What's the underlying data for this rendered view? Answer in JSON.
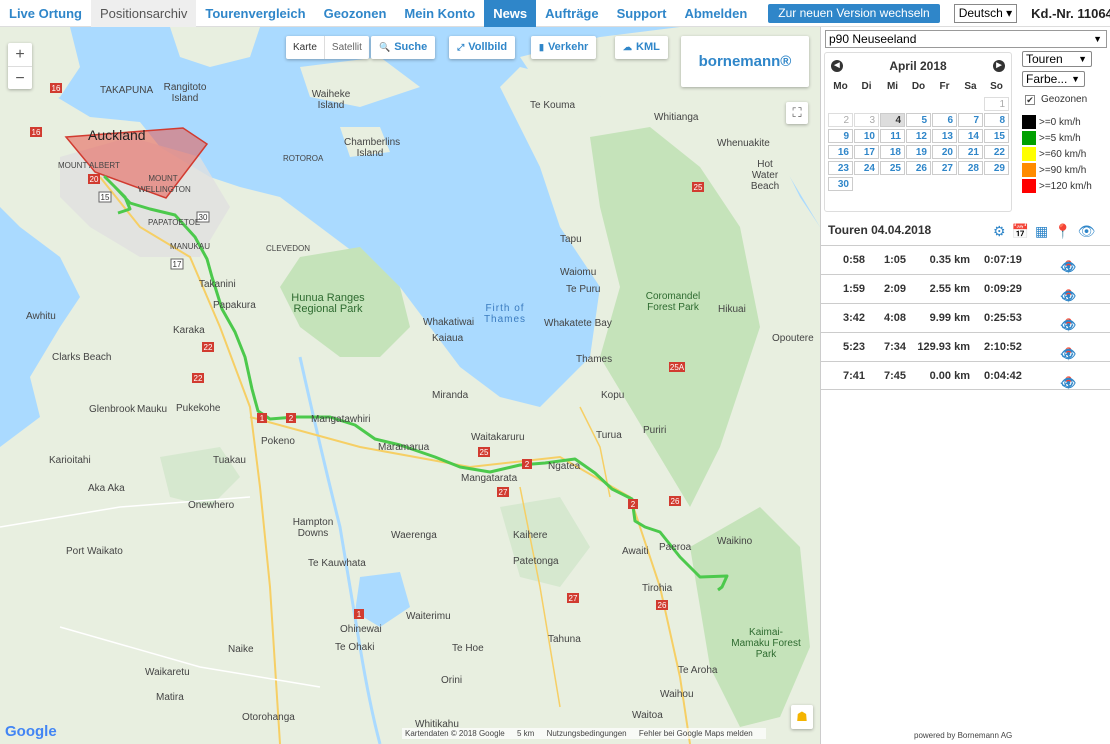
{
  "nav": {
    "items": [
      {
        "label": "Live Ortung"
      },
      {
        "label": "Positionsarchiv"
      },
      {
        "label": "Tourenvergleich"
      },
      {
        "label": "Geozonen"
      },
      {
        "label": "Mein Konto"
      },
      {
        "label": "News"
      },
      {
        "label": "Aufträge"
      },
      {
        "label": "Support"
      },
      {
        "label": "Abmelden"
      }
    ],
    "active": "News",
    "version_button": "Zur neuen Version wechseln",
    "language": "Deutsch",
    "customer_number": "Kd.-Nr. 11064"
  },
  "map": {
    "zoom_in": "+",
    "zoom_out": "−",
    "type_map": "Karte",
    "type_satellite": "Satellit",
    "buttons": {
      "search": "Suche",
      "fullscreen": "Vollbild",
      "traffic": "Verkehr",
      "kml": "KML"
    },
    "logo": "bornemann®",
    "google": "Google",
    "attribution": {
      "data": "Kartendaten © 2018 Google",
      "scale": "5 km",
      "terms": "Nutzungsbedingungen",
      "report": "Fehler bei Google Maps melden"
    },
    "labels": {
      "auckland": "Auckland",
      "takapuna": "TAKAPUNA",
      "rangitoto": "Rangitoto Island",
      "waiheke": "Waiheke Island",
      "chamberlins": "Chamberlins Island",
      "rotoroa": "ROTOROA",
      "tekouma": "Te Kouma",
      "whitianga": "Whitianga",
      "whenuakite": "Whenuakite",
      "hotwater": "Hot Water Beach",
      "mtalbert": "MOUNT ALBERT",
      "mtwellington": "MOUNT WELLINGTON",
      "manukau": "MANUKAU",
      "papatoetoe": "PAPATOETOE",
      "clevedon": "CLEVEDON",
      "tapu": "Tapu",
      "waiomu": "Waiomu",
      "tepuru": "Te Puru",
      "takanini": "Takanini",
      "papakura": "Papakura",
      "hunua": "Hunua Ranges Regional Park",
      "firth": "Firth of Thames",
      "coromandel": "Coromandel Forest Park",
      "hikuai": "Hikuai",
      "awhitu": "Awhitu",
      "karaka": "Karaka",
      "whakatiwai": "Whakatiwai",
      "kaiaua": "Kaiaua",
      "whakatete": "Whakatete Bay",
      "opoutere": "Opoutere",
      "clarks": "Clarks Beach",
      "thames": "Thames",
      "glenbrook": "Glenbrook",
      "mauku": "Mauku",
      "pukekohe": "Pukekohe",
      "miranda": "Miranda",
      "kopu": "Kopu",
      "mangatawhiri": "Mangatawhiri",
      "pokeno": "Pokeno",
      "waitakaruru": "Waitakaruru",
      "turua": "Turua",
      "puriri": "Puriri",
      "karioitahi": "Karioitahi",
      "tuakau": "Tuakau",
      "maramarua": "Maramarua",
      "mangatarata": "Mangatarata",
      "ngatea": "Ngatea",
      "aka": "Aka Aka",
      "onewhero": "Onewhero",
      "kaihere": "Kaihere",
      "awaiti": "Awaiti",
      "paeroa": "Paeroa",
      "waikino": "Waikino",
      "hampton": "Hampton Downs",
      "waerenga": "Waerenga",
      "patetonga": "Patetonga",
      "tirohia": "Tirohia",
      "portwaikato": "Port Waikato",
      "tekauwhata": "Te Kauwhata",
      "waiterimu": "Waiterimu",
      "ohinewai": "Ohinewai",
      "teohaki": "Te Ohaki",
      "tehoe": "Te Hoe",
      "tahuna": "Tahuna",
      "kaimai": "Kaimai-Mamaku Forest Park",
      "naike": "Naike",
      "waikaretu": "Waikaretu",
      "matira": "Matira",
      "orini": "Orini",
      "tearoha": "Te Aroha",
      "waihou": "Waihou",
      "waitoa": "Waitoa",
      "whitikahu": "Whitikahu",
      "otorohanga": "Otorohanga"
    }
  },
  "panel": {
    "vehicle": "p90 Neuseeland",
    "calendar": {
      "month": "April 2018",
      "dow": [
        "Mo",
        "Di",
        "Mi",
        "Do",
        "Fr",
        "Sa",
        "So"
      ],
      "days": [
        "",
        "",
        "",
        "",
        "",
        "",
        "1",
        "2",
        "3",
        "4",
        "5",
        "6",
        "7",
        "8",
        "9",
        "10",
        "11",
        "12",
        "13",
        "14",
        "15",
        "16",
        "17",
        "18",
        "19",
        "20",
        "21",
        "22",
        "23",
        "24",
        "25",
        "26",
        "27",
        "28",
        "29",
        "30"
      ]
    },
    "tours_select": "Touren",
    "color_select": "Farbe...",
    "geozonen_label": "Geozonen",
    "legend": [
      {
        "label": ">=0 km/h",
        "color": "#000000"
      },
      {
        "label": ">=5 km/h",
        "color": "#00a000"
      },
      {
        "label": ">=60 km/h",
        "color": "#ffff00"
      },
      {
        "label": ">=90 km/h",
        "color": "#ff8c00"
      },
      {
        "label": ">=120 km/h",
        "color": "#ff0000"
      }
    ],
    "tours_header": "Touren 04.04.2018",
    "tours": [
      {
        "start": "0:58",
        "end": "1:05",
        "distance": "0.35 km",
        "duration": "0:07:19"
      },
      {
        "start": "1:59",
        "end": "2:09",
        "distance": "2.55 km",
        "duration": "0:09:29"
      },
      {
        "start": "3:42",
        "end": "4:08",
        "distance": "9.99 km",
        "duration": "0:25:53"
      },
      {
        "start": "5:23",
        "end": "7:34",
        "distance": "129.93 km",
        "duration": "2:10:52"
      },
      {
        "start": "7:41",
        "end": "7:45",
        "distance": "0.00 km",
        "duration": "0:04:42"
      }
    ],
    "powered_by": "powered by Bornemann AG"
  },
  "colors": {
    "accent": "#2f86c9",
    "route": "#4cc94c",
    "water": "#aadaff",
    "land": "#e8efe0",
    "forest": "#c5e3ba",
    "geozone": "#e85a50"
  }
}
